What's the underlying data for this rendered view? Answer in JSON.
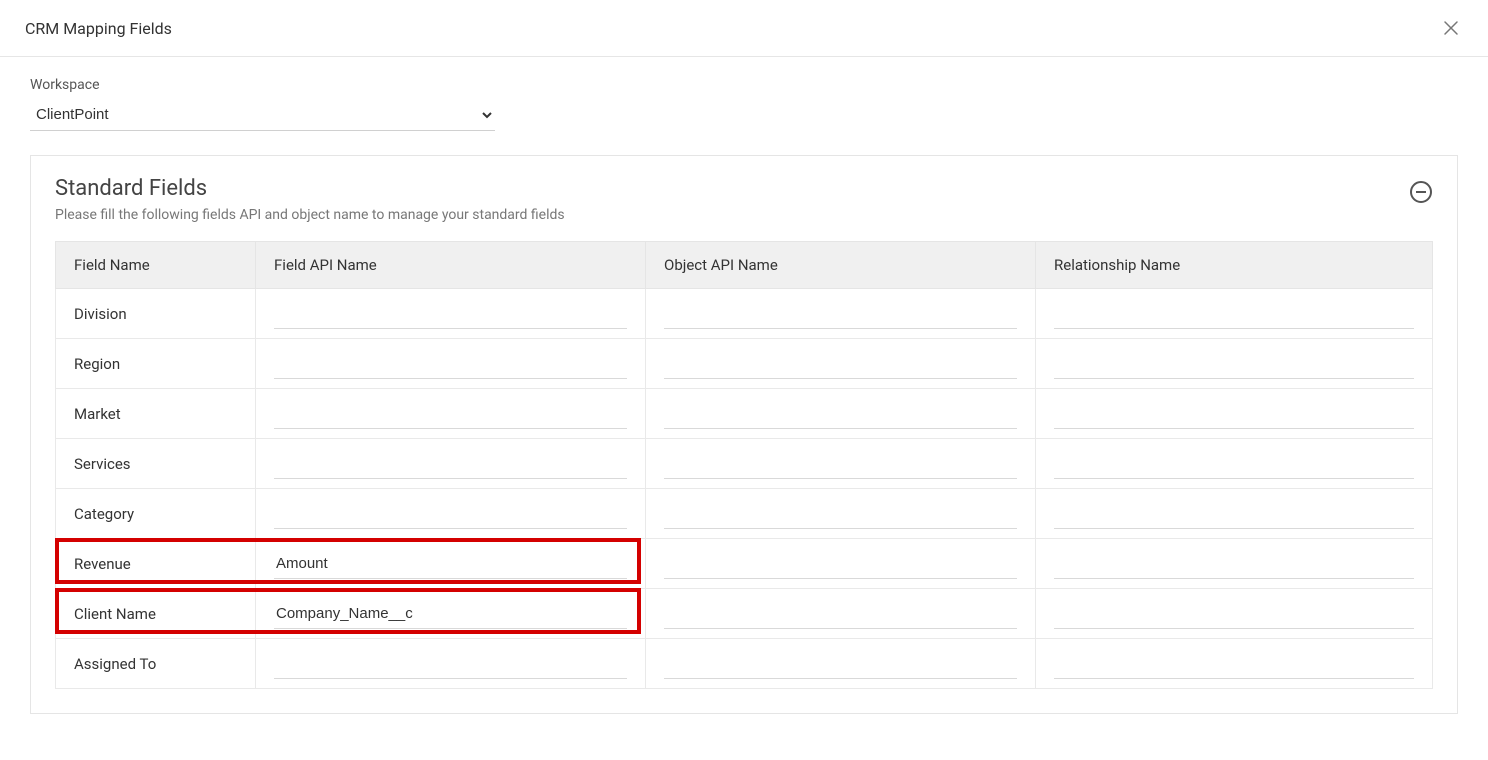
{
  "dialog": {
    "title": "CRM Mapping Fields"
  },
  "workspace": {
    "label": "Workspace",
    "value": "ClientPoint"
  },
  "panel": {
    "title": "Standard Fields",
    "subtitle": "Please fill the following fields API and object name to manage your standard fields"
  },
  "table": {
    "headers": {
      "field_name": "Field Name",
      "field_api": "Field API Name",
      "object_api": "Object API Name",
      "relationship": "Relationship Name"
    },
    "rows": [
      {
        "name": "Division",
        "api": "",
        "object": "",
        "rel": ""
      },
      {
        "name": "Region",
        "api": "",
        "object": "",
        "rel": ""
      },
      {
        "name": "Market",
        "api": "",
        "object": "",
        "rel": ""
      },
      {
        "name": "Services",
        "api": "",
        "object": "",
        "rel": ""
      },
      {
        "name": "Category",
        "api": "",
        "object": "",
        "rel": ""
      },
      {
        "name": "Revenue",
        "api": "Amount",
        "object": "",
        "rel": ""
      },
      {
        "name": "Client Name",
        "api": "Company_Name__c",
        "object": "",
        "rel": ""
      },
      {
        "name": "Assigned To",
        "api": "",
        "object": "",
        "rel": ""
      }
    ]
  }
}
